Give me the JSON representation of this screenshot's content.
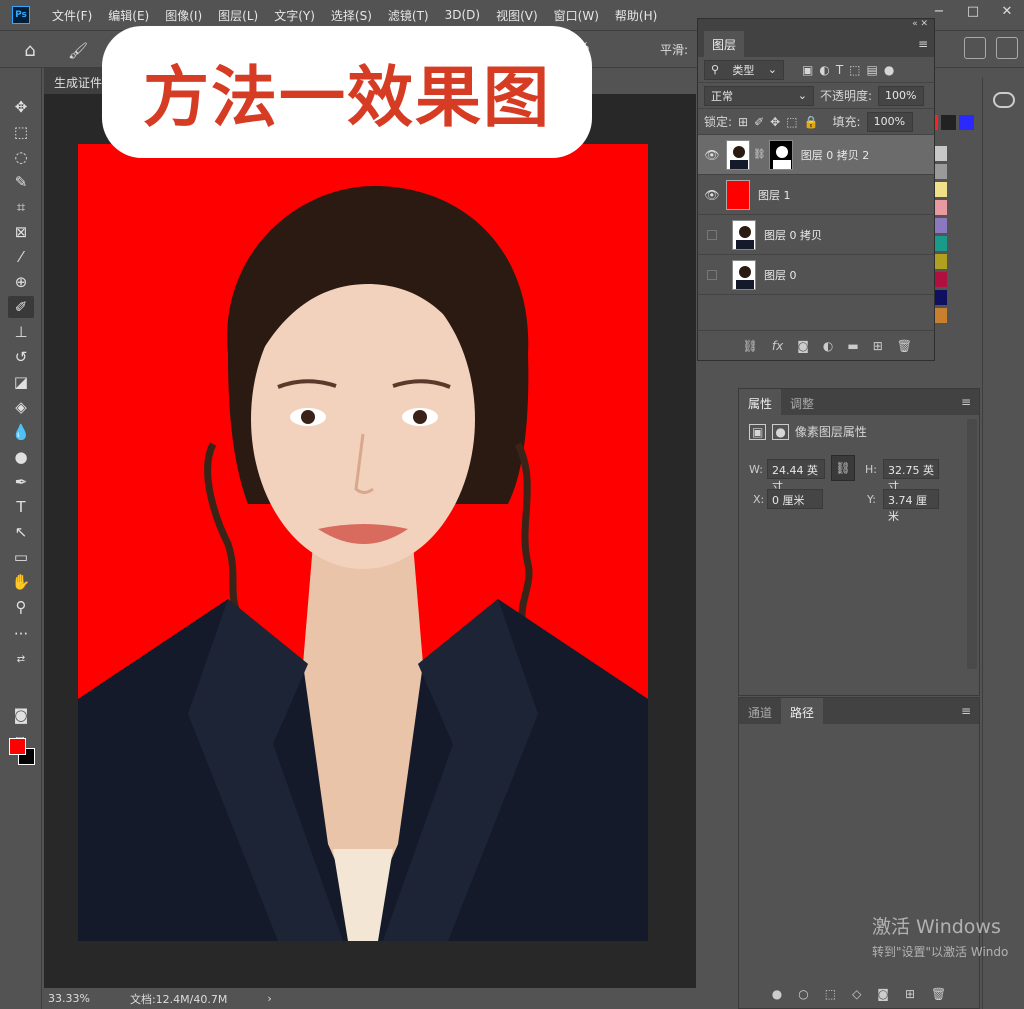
{
  "app": {
    "logo": "Ps"
  },
  "menu": [
    "文件(F)",
    "编辑(E)",
    "图像(I)",
    "图层(L)",
    "文字(Y)",
    "选择(S)",
    "滤镜(T)",
    "3D(D)",
    "视图(V)",
    "窗口(W)",
    "帮助(H)"
  ],
  "window_controls": [
    "−",
    "□",
    "✕"
  ],
  "options_bar": {
    "percent": "%",
    "smooth_label": "平滑:"
  },
  "headline": "方法一效果图",
  "document_tab": "生成证件照",
  "status": {
    "zoom": "33.33%",
    "doc_size": "文档:12.4M/40.7M"
  },
  "colors": {
    "foreground": "#ff0000",
    "background": "#000000",
    "canvas_bg": "#ff0000"
  },
  "layers_panel": {
    "title": "图层",
    "filter_label": "类型",
    "blend_mode": "正常",
    "opacity_label": "不透明度:",
    "opacity_value": "100%",
    "lock_label": "锁定:",
    "fill_label": "填充:",
    "fill_value": "100%",
    "layers": [
      {
        "name": "图层 0 拷贝 2",
        "visible": true,
        "selected": true,
        "thumb": "photo",
        "mask": true
      },
      {
        "name": "图层 1",
        "visible": true,
        "selected": false,
        "thumb": "red",
        "mask": false
      },
      {
        "name": "图层 0 拷贝",
        "visible": false,
        "selected": false,
        "thumb": "photo",
        "mask": false
      },
      {
        "name": "图层 0",
        "visible": false,
        "selected": false,
        "thumb": "photo",
        "mask": false
      }
    ],
    "footer_icons": [
      "link-icon",
      "fx-icon",
      "mask-icon",
      "adjustment-icon",
      "folder-icon",
      "new-layer-icon",
      "trash-icon"
    ]
  },
  "properties_panel": {
    "tabs": [
      "属性",
      "调整"
    ],
    "section_title": "像素图层属性",
    "w_label": "W:",
    "w_value": "24.44 英寸",
    "h_label": "H:",
    "h_value": "32.75 英寸",
    "x_label": "X:",
    "x_value": "0 厘米",
    "y_label": "Y:",
    "y_value": "3.74 厘米"
  },
  "paths_panel": {
    "tabs": [
      "通道",
      "路径"
    ]
  },
  "watermark": {
    "line1": "激活 Windows",
    "line2": "转到\"设置\"以激活 Windo"
  }
}
